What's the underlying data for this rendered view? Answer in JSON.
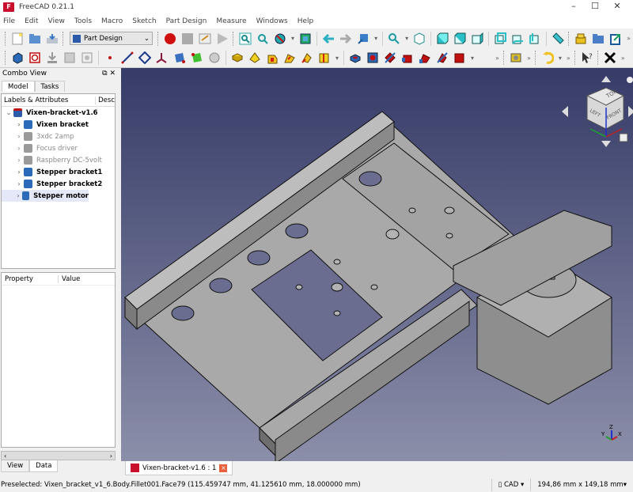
{
  "window": {
    "title": "FreeCAD 0.21.1",
    "minimize": "–",
    "maximize": "☐",
    "close": "✕"
  },
  "menu": [
    "File",
    "Edit",
    "View",
    "Tools",
    "Macro",
    "Sketch",
    "Part Design",
    "Measure",
    "Windows",
    "Help"
  ],
  "toolbar": {
    "workbench": "Part Design",
    "overflow": "»"
  },
  "combo": {
    "title": "Combo View",
    "tabs": [
      "Model",
      "Tasks"
    ],
    "tree_headers": [
      "Labels & Attributes",
      "Desc"
    ],
    "root": "Vixen-bracket-v1.6",
    "items": [
      {
        "label": "Vixen bracket",
        "state": "visible"
      },
      {
        "label": "3xdc 2amp",
        "state": "hidden"
      },
      {
        "label": "Focus driver",
        "state": "hidden"
      },
      {
        "label": "Raspberry DC-5volt",
        "state": "hidden"
      },
      {
        "label": "Stepper bracket1",
        "state": "visible"
      },
      {
        "label": "Stepper bracket2",
        "state": "visible"
      },
      {
        "label": "Stepper motor",
        "state": "selected"
      }
    ],
    "prop_headers": [
      "Property",
      "Value"
    ],
    "bottom_tabs": [
      "View",
      "Data"
    ]
  },
  "navcube": {
    "top": "TOP",
    "left": "LEFT",
    "front": "FRONT"
  },
  "axes": {
    "x": "X",
    "y": "Y",
    "z": "Z"
  },
  "document_tab": "Vixen-bracket-v1.6 : 1",
  "status": {
    "message": "Preselected: Vixen_bracket_v1_6.Body.Fillet001.Face79 (115.459747 mm, 41.125610 mm, 18.000000 mm)",
    "nav_style": "CAD",
    "dimensions": "194,86 mm x 149,18 mm"
  }
}
